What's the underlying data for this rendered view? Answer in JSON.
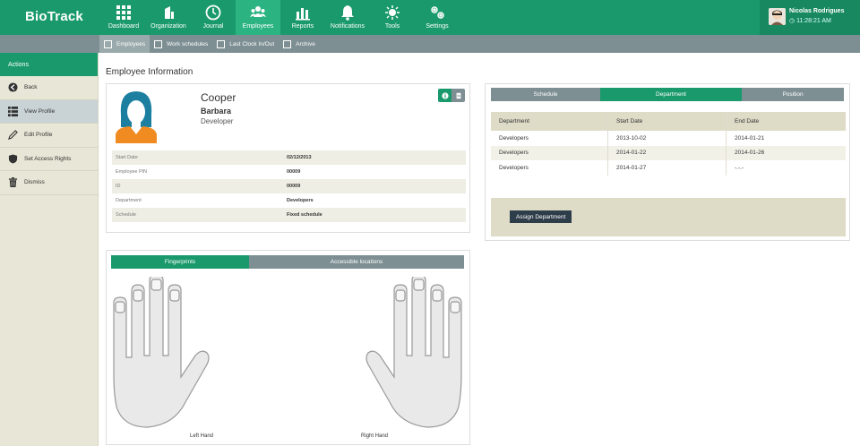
{
  "app": {
    "title": "BioTrack"
  },
  "nav": [
    {
      "label": "Dashboard",
      "icon": "dashboard-icon"
    },
    {
      "label": "Organization",
      "icon": "organization-icon"
    },
    {
      "label": "Journal",
      "icon": "journal-icon"
    },
    {
      "label": "Employees",
      "icon": "employees-icon",
      "active": true
    },
    {
      "label": "Reports",
      "icon": "reports-icon"
    },
    {
      "label": "Notifications",
      "icon": "bell-icon"
    },
    {
      "label": "Tools",
      "icon": "tools-icon"
    },
    {
      "label": "Settings",
      "icon": "settings-icon"
    }
  ],
  "user": {
    "name": "Nicolas Rodrigues",
    "time": "11:28:21 AM"
  },
  "subnav": [
    {
      "label": "Employees",
      "active": true
    },
    {
      "label": "Work schedules"
    },
    {
      "label": "Last Clock In/Out"
    },
    {
      "label": "Archive"
    }
  ],
  "sidebar": {
    "header": "Actions",
    "items": [
      {
        "label": "Back",
        "icon": "back-icon"
      },
      {
        "label": "View Profile",
        "icon": "grid-icon",
        "active": true
      },
      {
        "label": "Edit Profile",
        "icon": "pencil-icon"
      },
      {
        "label": "Set Access Rights",
        "icon": "shield-icon"
      },
      {
        "label": "Dismiss",
        "icon": "trash-icon"
      }
    ]
  },
  "page": {
    "title": "Employee Information"
  },
  "employee": {
    "last_name": "Cooper",
    "first_name": "Barbara",
    "role": "Developer",
    "fields": [
      {
        "key": "Start Date",
        "value": "02/12/2013"
      },
      {
        "key": "Employee PIN",
        "value": "00009"
      },
      {
        "key": "ID",
        "value": "00009"
      },
      {
        "key": "Department",
        "value": "Developers"
      },
      {
        "key": "Schedule",
        "value": "Fixed schedule"
      }
    ]
  },
  "dept_panel": {
    "tabs": [
      "Schedule",
      "Department",
      "Position"
    ],
    "active_tab": "Department",
    "columns": [
      "Department",
      "Start Date",
      "End Date"
    ],
    "rows": [
      [
        "Developers",
        "2013-10-02",
        "2014-01-21"
      ],
      [
        "Developers",
        "2014-01-22",
        "2014-01-26"
      ],
      [
        "Developers",
        "2014-01-27",
        "-.-.-"
      ]
    ],
    "assign_button": "Assign Department"
  },
  "fingerprints": {
    "tabs": [
      "Fingerprints",
      "Accessible locations"
    ],
    "active_tab": "Fingerprints",
    "left_label": "Left Hand",
    "right_label": "Right Hand"
  },
  "colors": {
    "primary": "#1a9a6c",
    "secondary": "#7d8f93",
    "sidebar": "#e8e6d6",
    "beige": "#dedbc7"
  }
}
